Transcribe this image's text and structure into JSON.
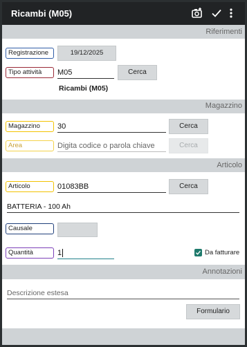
{
  "topbar": {
    "title": "Ricambi (M05)",
    "icons": [
      "camera-add-icon",
      "check-icon",
      "more-vert-icon"
    ]
  },
  "sections": {
    "riferimenti": "Riferimenti",
    "magazzino": "Magazzino",
    "articolo": "Articolo",
    "annotazioni": "Annotazioni"
  },
  "riferimenti": {
    "registrazione_label": "Registrazione",
    "registrazione_value": "19/12/2025",
    "tipo_label": "Tipo attività",
    "tipo_value": "M05",
    "cerca_label": "Cerca",
    "tipo_description": "Ricambi (M05)"
  },
  "magazzino": {
    "magazzino_label": "Magazzino",
    "magazzino_value": "30",
    "magazzino_cerca": "Cerca",
    "area_label": "Area",
    "area_placeholder": "Digita codice o parola chiave",
    "area_cerca": "Cerca"
  },
  "articolo": {
    "articolo_label": "Articolo",
    "articolo_value": "01083BB",
    "articolo_cerca": "Cerca",
    "description": "BATTERIA - 100 Ah",
    "causale_label": "Causale",
    "causale_value": "",
    "quantita_label": "Quantità",
    "quantita_value": "1",
    "da_fatturare_label": "Da fatturare",
    "da_fatturare_checked": true
  },
  "annotazioni": {
    "descrizione_placeholder": "Descrizione estesa",
    "formulario_label": "Formulario"
  },
  "colors": {
    "topbar": "#212325",
    "section_bg": "#cfd3d6",
    "accent_teal": "#20808a",
    "checkbox": "#1f7a6c"
  }
}
